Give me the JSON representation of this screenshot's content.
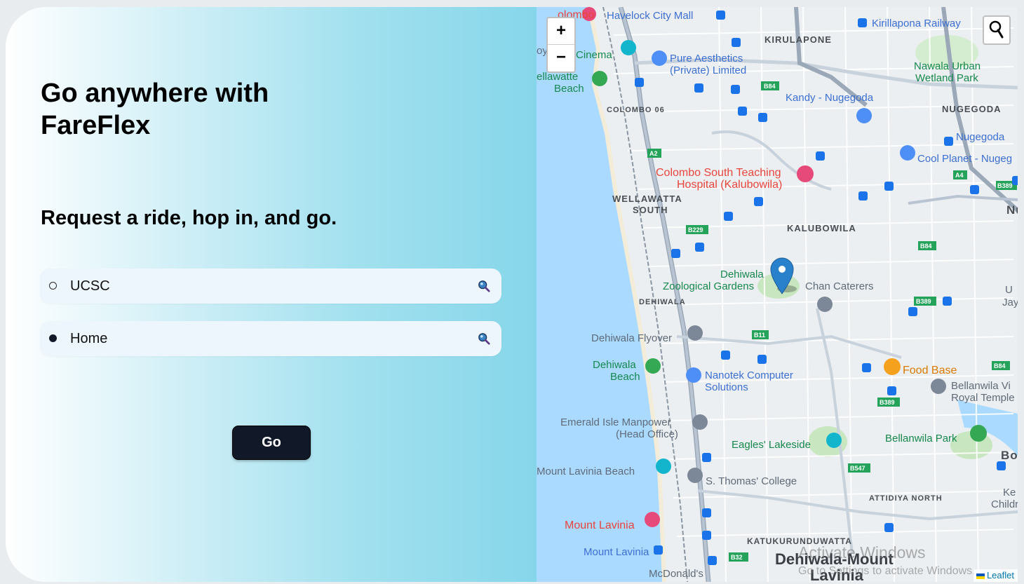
{
  "hero": {
    "title": "Go anywhere with FareFlex",
    "subtitle": "Request a ride, hop in, and go."
  },
  "form": {
    "pickup": "UCSC",
    "destination": "Home",
    "go_label": "Go"
  },
  "map": {
    "zoom_in": "+",
    "zoom_out": "−",
    "attribution": "Leaflet",
    "watermark_line1": "Activate Windows",
    "watermark_line2": "Go to Settings to activate Windows.",
    "labels": {
      "havelock": "Havelock City Mall",
      "kirulapone": "KIRULAPONE",
      "kirillapona_railway": "Kirillapona Railway",
      "cinema": "Cinema",
      "pure_aesthetics_1": "Pure Aesthetics",
      "pure_aesthetics_2": "(Private) Limited",
      "nawala_1": "Nawala Urban",
      "nawala_2": "Wetland Park",
      "wellawatte_beach_1": "ellawatte",
      "wellawatte_beach_2": "Beach",
      "colombo06": "COLOMBO 06",
      "b84_top": "B84",
      "kandy_nugegoda": "Kandy - Nugegoda",
      "nugegoda_caps": "NUGEGODA",
      "nugegoda": "Nugegoda",
      "cool_planet": "Cool Planet - Nugeg",
      "a2": "A2",
      "colombo_south_1": "Colombo South Teaching",
      "colombo_south_2": "Hospital (Kalubowila)",
      "a4": "A4",
      "b389_right": "B389",
      "nu": "Nu",
      "wellawatta_south_1": "WELLAWATTA",
      "wellawatta_south_2": "SOUTH",
      "b229": "B229",
      "kalubowila": "KALUBOWILA",
      "b84_mid": "B84",
      "dehiwala_zoo_1": "Dehiwala",
      "dehiwala_zoo_2": "Zoological Gardens",
      "chan_caterers": "Chan Caterers",
      "dehiwala": "DEHIWALA",
      "b389_mid": "B389",
      "dehiwala_flyover": "Dehiwala Flyover",
      "b11": "B11",
      "dehiwala_beach_1": "Dehiwala",
      "dehiwala_beach_2": "Beach",
      "nanotek_1": "Nanotek Computer",
      "nanotek_2": "Solutions",
      "food_base": "Food Base",
      "b84_right": "B84",
      "bellanwila_vihara_1": "Bellanwila Vi",
      "bellanwila_vihara_2": "Royal Temple",
      "b389_low": "B389",
      "emerald_1": "Emerald Isle Manpower",
      "emerald_2": "(Head Office)",
      "eagles": "Eagles' Lakeside",
      "bellanwila_park": "Bellanwila Park",
      "bo": "Bo",
      "mount_lavinia_beach": "Mount Lavinia Beach",
      "s_thomas": "S. Thomas' College",
      "b547": "B547",
      "ke_1": "Ke",
      "ke_2": "Childr",
      "attidiya_north": "ATTIDIYA NORTH",
      "mount_lavinia_hotel": "Mount Lavinia",
      "katukurunduwatta": "KATUKURUNDUWATTA",
      "mount_lavinia_station": "Mount Lavinia",
      "b32": "B32",
      "dehiwala_mount_1": "Dehiwala-Mount",
      "dehiwala_mount_2": "Lavinia",
      "mcdonalds": "McDonald's",
      "colombo_edge": "olombo",
      "oy": "oy",
      "u": "U",
      "jay": "Jay"
    }
  },
  "colors": {
    "button_dark": "#111827",
    "field_bg": "#eef6fd",
    "sea": "#aadaff",
    "marker": "#2a81cb",
    "bus_stop": "#1a73e8"
  }
}
